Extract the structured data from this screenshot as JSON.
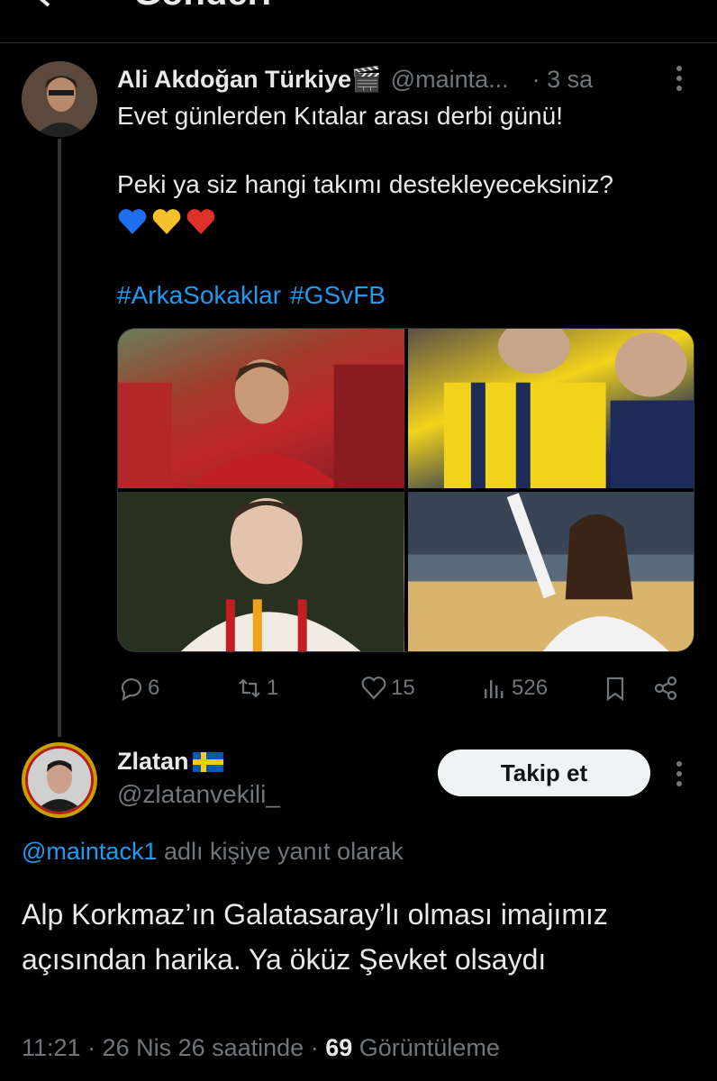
{
  "header": {
    "title": "Gönderi"
  },
  "tweet": {
    "author_name": "Ali Akdoğan Türkiye🎬",
    "handle": "@mainta...",
    "time": "· 3 sa",
    "text_lines": [
      "Evet günlerden Kıtalar arası derbi günü!",
      "",
      "Peki ya siz hangi takımı destekleyeceksiniz?"
    ],
    "emojis": [
      "blue-heart",
      "yellow-heart",
      "red-heart"
    ],
    "hashtags": [
      "#ArkaSokaklar",
      "#GSvFB"
    ],
    "media": [
      "photo-galatasaray-fan",
      "photo-fenerbahce-fans",
      "photo-man-galatasaray-jersey",
      "photo-woman-basketball-arena"
    ],
    "stats": {
      "replies": "6",
      "retweets": "1",
      "likes": "15",
      "views": "526"
    }
  },
  "reply": {
    "author_name": "Zlatan",
    "flag": "sweden-flag",
    "handle": "@zlatanvekili_",
    "follow_label": "Takip et",
    "reply_to_mention": "@maintack1",
    "reply_to_suffix": " adlı kişiye yanıt olarak",
    "text": "Alp Korkmaz’ın Galatasaray’lı olması imajımız açısından harika. Ya öküz Şevket olsaydı",
    "time": "11:21 · 26 Nis 26 saatinde · ",
    "views_count": "69",
    "views_label": " Görüntüleme"
  },
  "colors": {
    "accent": "#1d9bf0",
    "muted": "#71767b",
    "text": "#e7e9ea",
    "background": "#000000"
  }
}
